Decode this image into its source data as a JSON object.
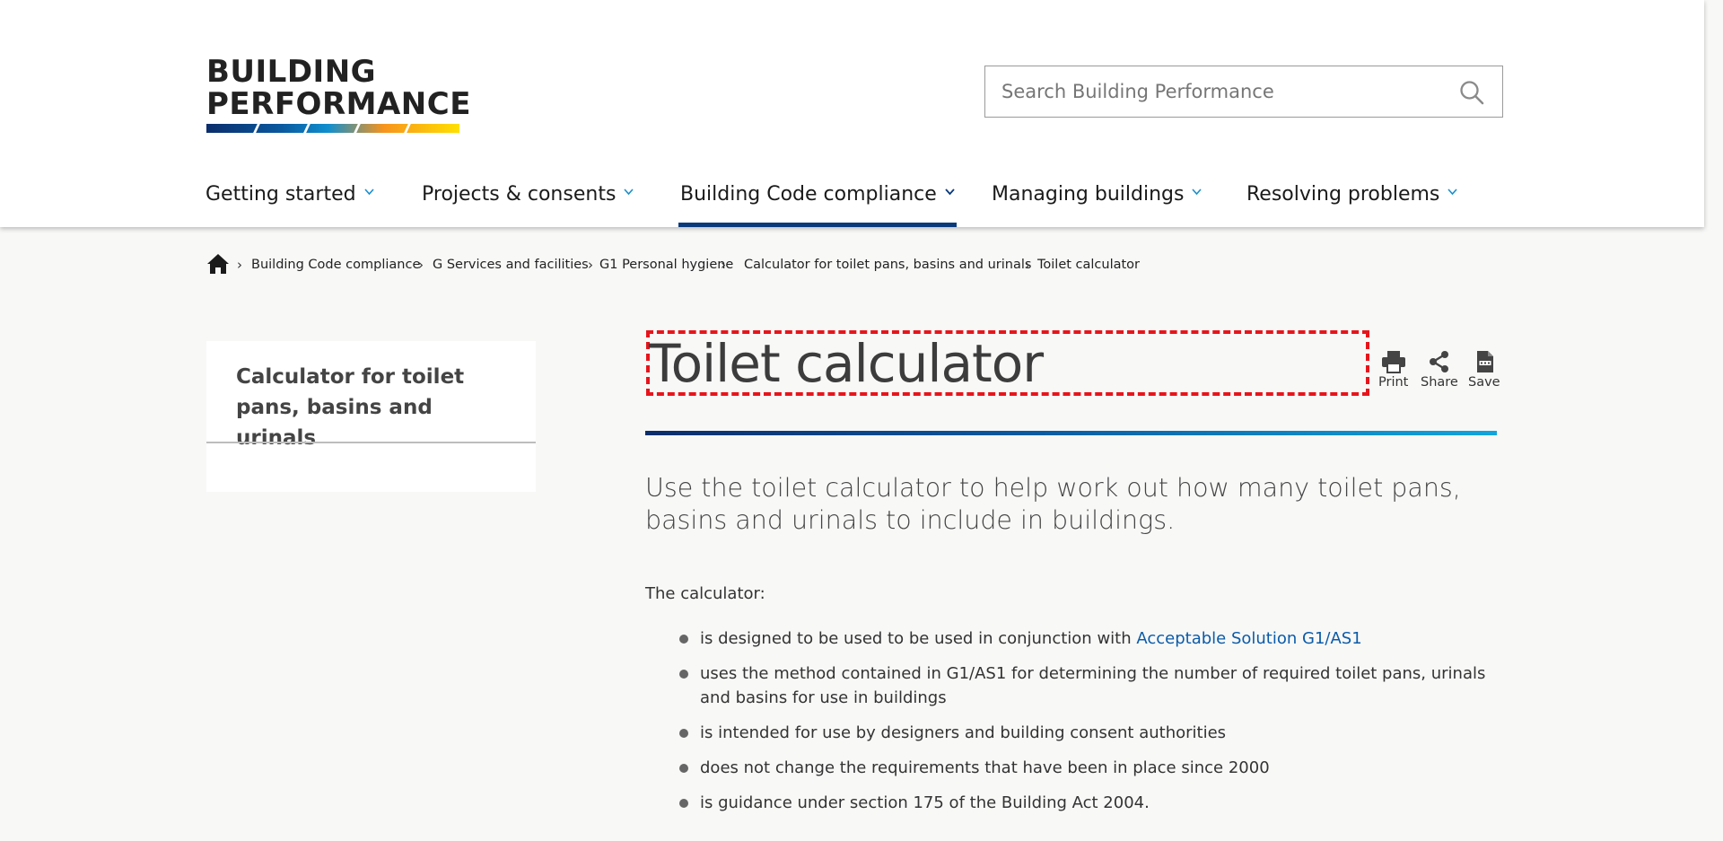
{
  "header": {
    "logo": {
      "line1": "BUILDING",
      "line2": "PERFORMANCE"
    },
    "search": {
      "placeholder": "Search Building Performance",
      "icon": "search-icon"
    },
    "nav": [
      {
        "label": "Getting started",
        "active": false
      },
      {
        "label": "Projects & consents",
        "active": false
      },
      {
        "label": "Building Code compliance",
        "active": true
      },
      {
        "label": "Managing buildings",
        "active": false
      },
      {
        "label": "Resolving problems",
        "active": false
      }
    ],
    "colors": {
      "nav_active": "#0a3a7a",
      "chevron": "#1a8fd0",
      "link": "#0b5ba8",
      "highlight_box": "#e8141b"
    }
  },
  "breadcrumb": {
    "home_icon": "home-icon",
    "items": [
      "Building Code compliance",
      "G Services and facilities",
      "G1 Personal hygiene",
      "Calculator for toilet pans, basins and urinals",
      "Toilet calculator"
    ]
  },
  "sidenav": {
    "title": "Calculator for toilet pans, basins and urinals"
  },
  "page": {
    "title": "Toilet calculator",
    "tools": [
      {
        "label": "Print",
        "icon": "print-icon"
      },
      {
        "label": "Share",
        "icon": "share-icon"
      },
      {
        "label": "Save",
        "icon": "pdf-icon"
      }
    ],
    "intro": "Use the toilet calculator to help work out how many toilet pans, basins and urinals to include in buildings.",
    "lead": "The calculator:",
    "list": {
      "item1_text": "is designed to be used to be used in conjunction with ",
      "item1_link": "Acceptable Solution G1/AS1",
      "item2": "uses the method contained in G1/AS1 for determining the number of required toilet pans, urinals and basins for use in buildings",
      "item3": "is intended for use by designers and building consent authorities",
      "item4": "does not change the requirements that have been in place since 2000",
      "item5": "is guidance under section 175 of the Building Act 2004."
    }
  }
}
